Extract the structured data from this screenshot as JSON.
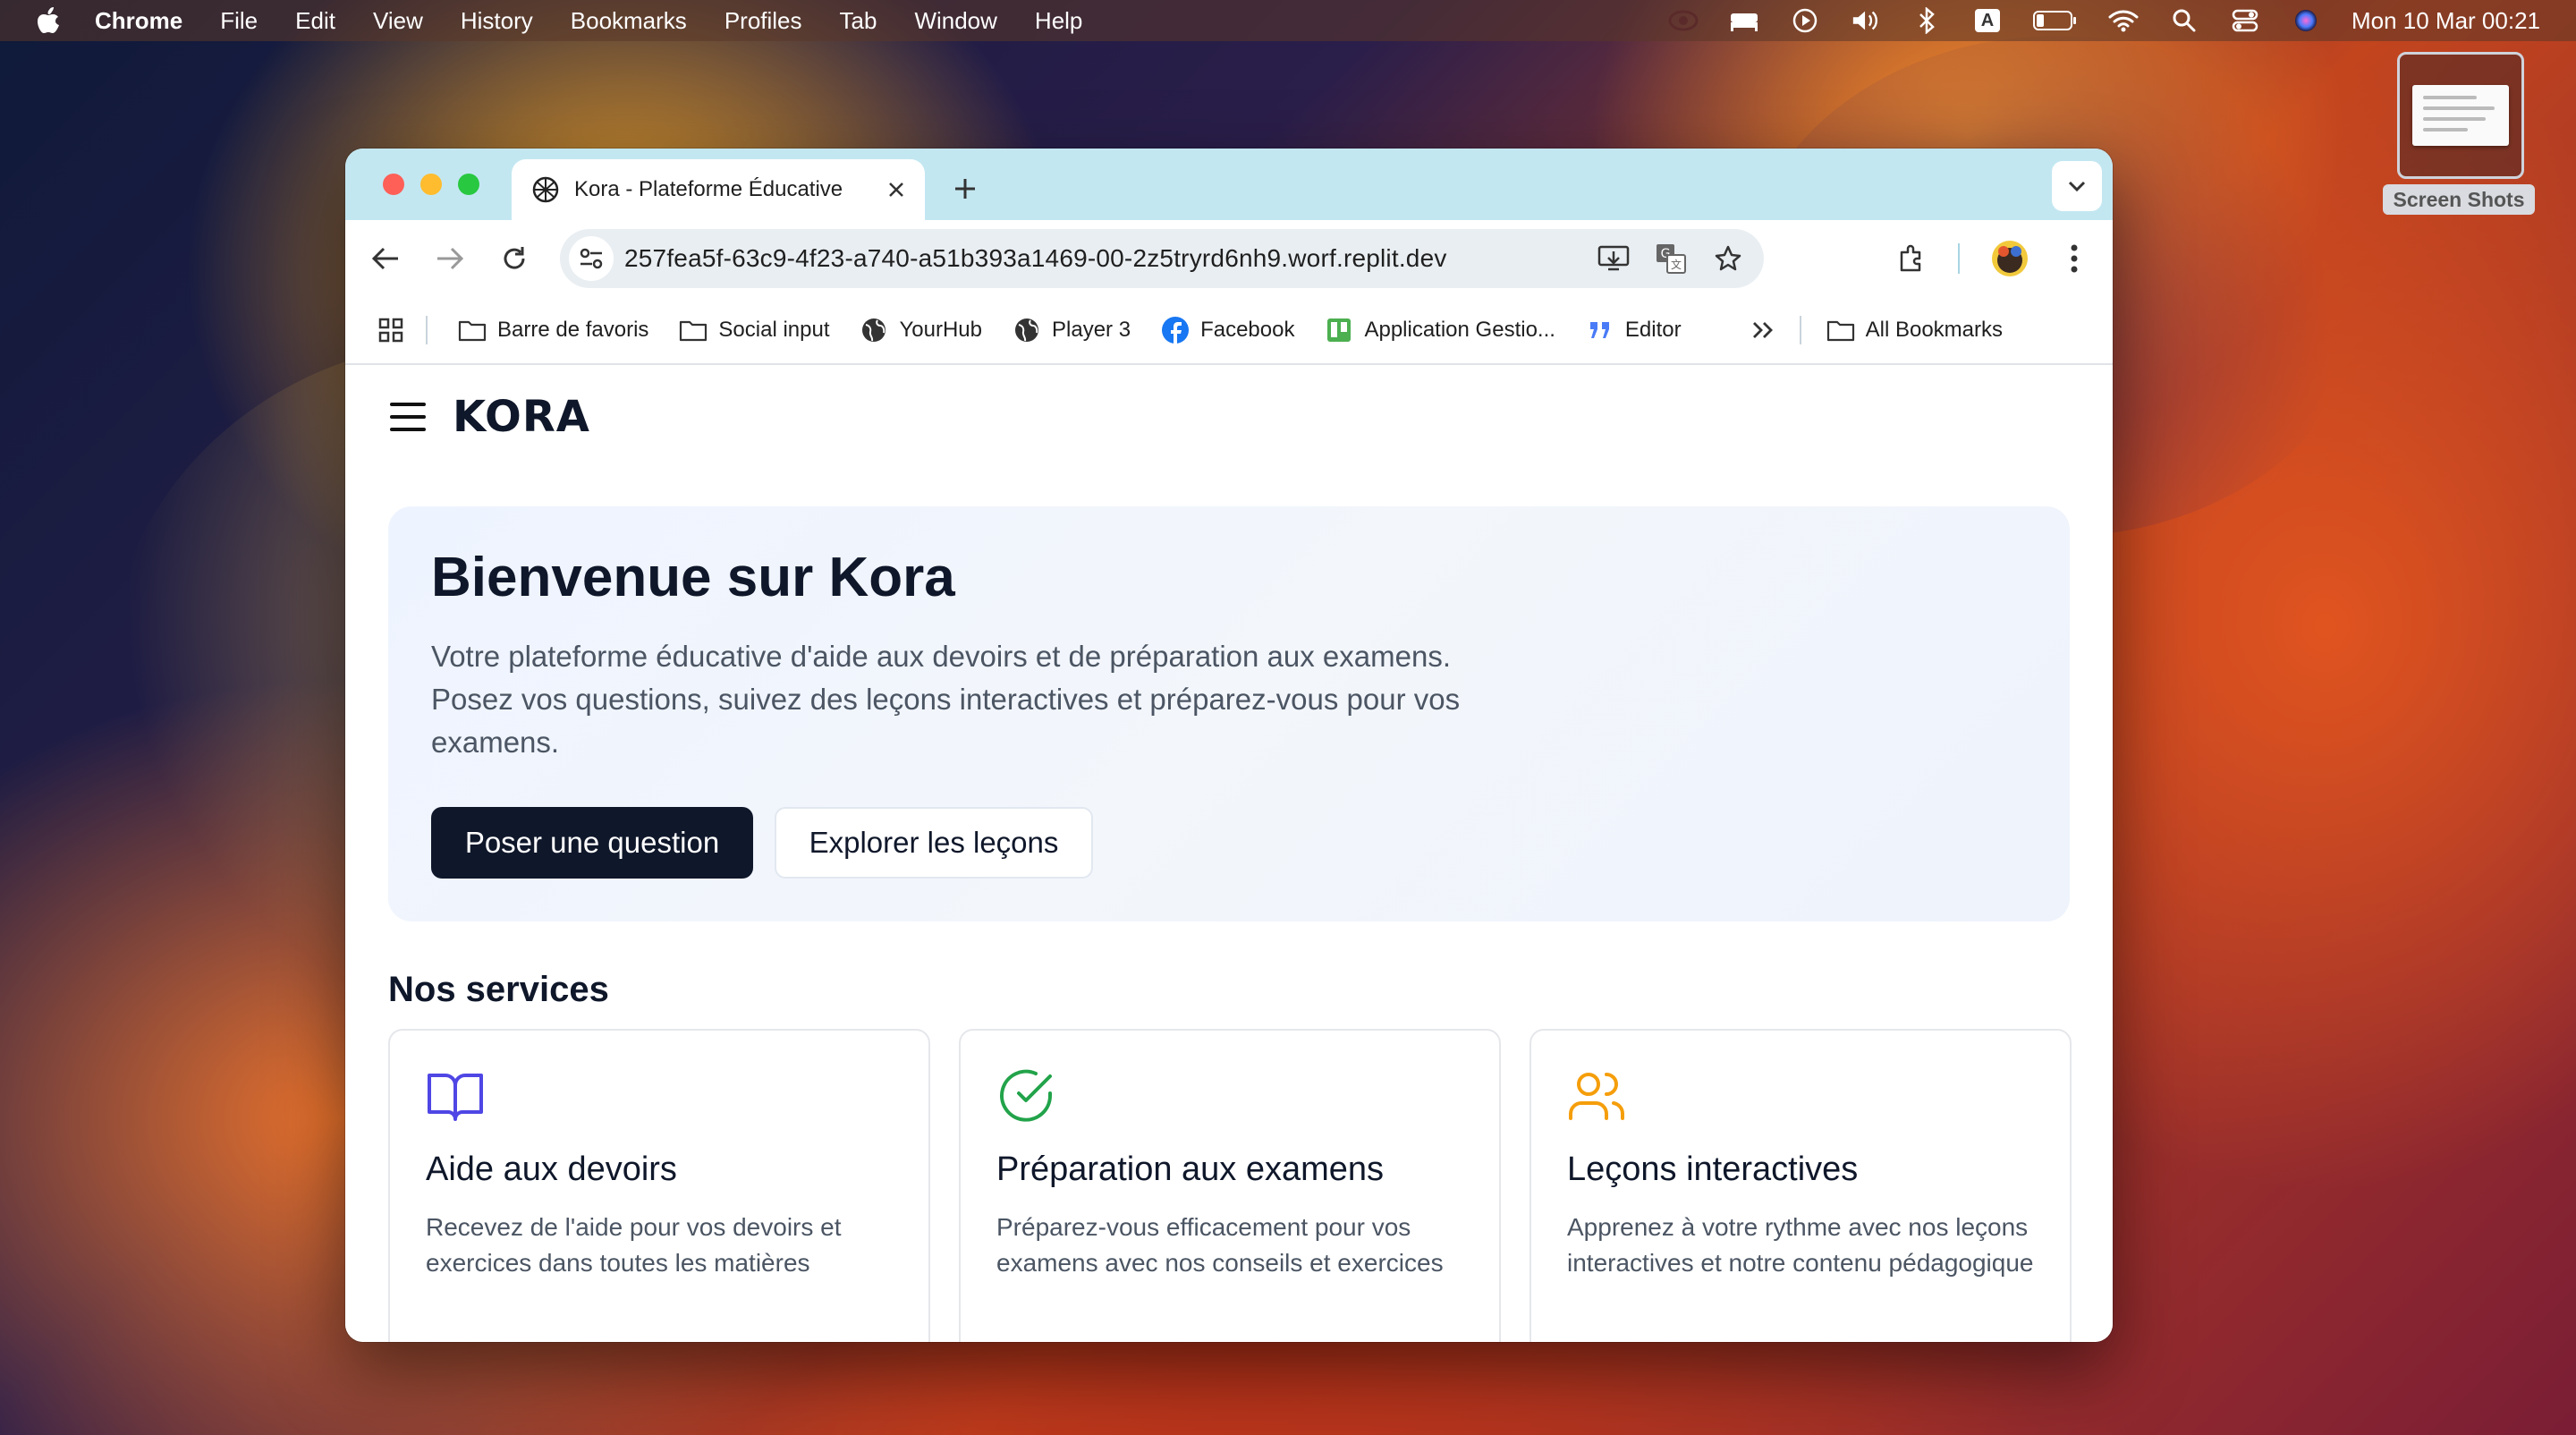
{
  "menubar": {
    "app_name": "Chrome",
    "items": [
      "File",
      "Edit",
      "View",
      "History",
      "Bookmarks",
      "Profiles",
      "Tab",
      "Window",
      "Help"
    ],
    "clock": "Mon 10 Mar  00:21",
    "status_icons": [
      "creative-cloud-icon",
      "bed-icon",
      "play-icon",
      "volume-icon",
      "bluetooth-icon",
      "input-source-icon",
      "battery-icon",
      "wifi-icon",
      "spotlight-search-icon",
      "control-center-icon",
      "siri-icon"
    ],
    "input_source_letter": "A"
  },
  "desktop": {
    "folder_label": "Screen Shots"
  },
  "browser": {
    "tab_title": "Kora - Plateforme Éducative",
    "url": "257fea5f-63c9-4f23-a740-a51b393a1469-00-2z5tryrd6nh9.worf.replit.dev",
    "bookmarks": [
      {
        "label": "Barre de favoris",
        "icon": "folder-icon"
      },
      {
        "label": "Social input",
        "icon": "folder-icon"
      },
      {
        "label": "YourHub",
        "icon": "globe-icon"
      },
      {
        "label": "Player 3",
        "icon": "globe-icon"
      },
      {
        "label": "Facebook",
        "icon": "facebook-icon"
      },
      {
        "label": "Application Gestio...",
        "icon": "trello-icon"
      },
      {
        "label": "Editor",
        "icon": "quote-icon"
      }
    ],
    "all_bookmarks": "All Bookmarks"
  },
  "page": {
    "logo": "KORA",
    "hero": {
      "title": "Bienvenue sur Kora",
      "description": "Votre plateforme éducative d'aide aux devoirs et de préparation aux examens. Posez vos questions, suivez des leçons interactives et préparez-vous pour vos examens.",
      "primary_button": "Poser une question",
      "secondary_button": "Explorer les leçons"
    },
    "services_title": "Nos services",
    "services": [
      {
        "title": "Aide aux devoirs",
        "description": "Recevez de l'aide pour vos devoirs et exercices dans toutes les matières",
        "icon": "book-open-icon",
        "color": "#4f46e5"
      },
      {
        "title": "Préparation aux examens",
        "description": "Préparez-vous efficacement pour vos examens avec nos conseils et exercices",
        "icon": "check-circle-icon",
        "color": "#22a34a"
      },
      {
        "title": "Leçons interactives",
        "description": "Apprenez à votre rythme avec nos leçons interactives et notre contenu pédagogique",
        "icon": "users-icon",
        "color": "#f59e0b"
      }
    ]
  },
  "colors": {
    "tabstrip": "#c3e7f1",
    "primary": "#0f172a",
    "hero_bg": "#eef4ff"
  }
}
